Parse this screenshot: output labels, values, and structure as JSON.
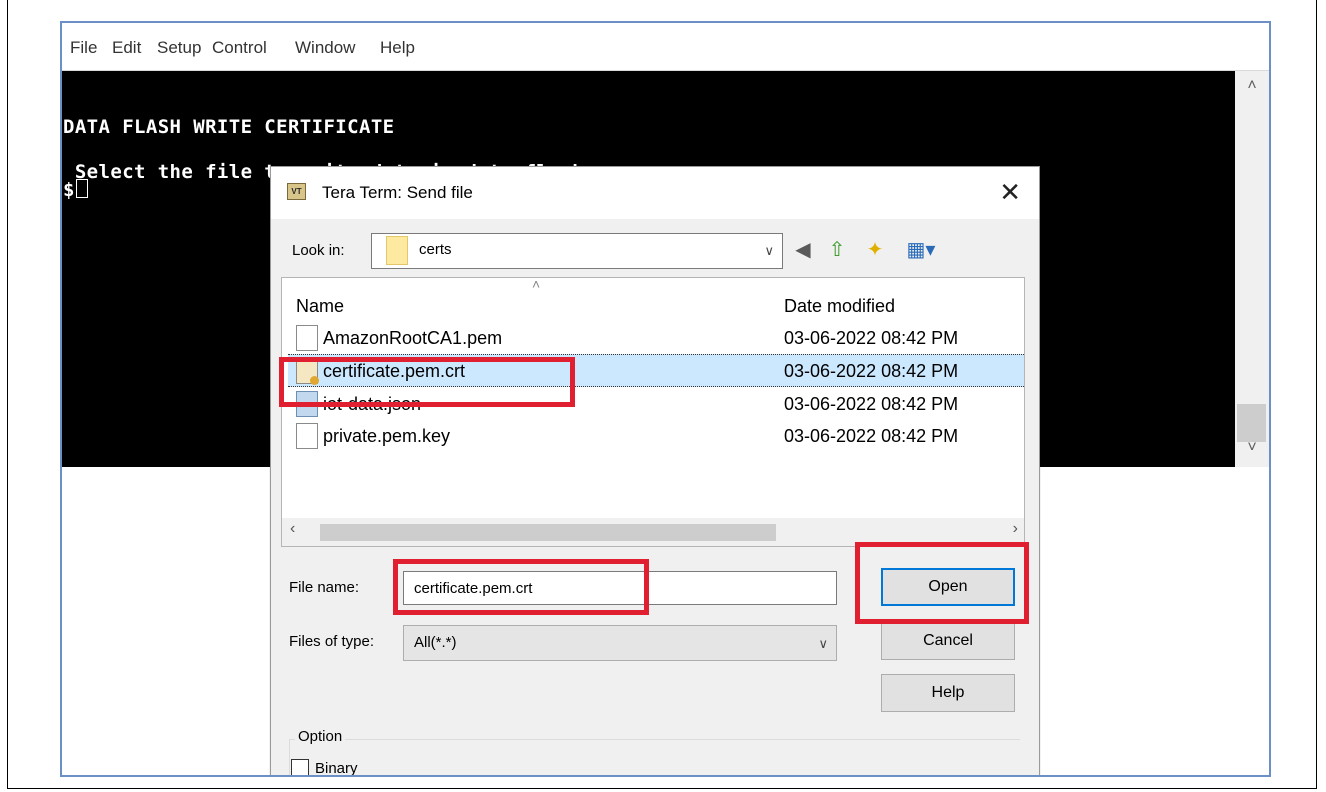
{
  "menu": [
    "File",
    "Edit",
    "Setup",
    "Control",
    "Window",
    "Help"
  ],
  "terminal": {
    "line1": "DATA FLASH WRITE CERTIFICATE",
    "line2": " Select the file to write data in data flash",
    "prompt": "$"
  },
  "dialog": {
    "title": "Tera Term: Send file",
    "icon_label": "VT",
    "look_in_label": "Look in:",
    "look_in_value": "certs",
    "columns": {
      "name": "Name",
      "date": "Date modified"
    },
    "files": [
      {
        "name": "AmazonRootCA1.pem",
        "date": "03-06-2022 08:42 PM",
        "icon": "file-icon"
      },
      {
        "name": "certificate.pem.crt",
        "date": "03-06-2022 08:42 PM",
        "icon": "certificate-icon",
        "selected": true
      },
      {
        "name": "iot-data.json",
        "date": "03-06-2022 08:42 PM",
        "icon": "json-file-icon"
      },
      {
        "name": "private.pem.key",
        "date": "03-06-2022 08:42 PM",
        "icon": "file-icon"
      }
    ],
    "file_name_label": "File name:",
    "file_name_value": "certificate.pem.crt",
    "files_of_type_label": "Files of type:",
    "files_of_type_value": "All(*.*)",
    "buttons": {
      "open": "Open",
      "cancel": "Cancel",
      "help": "Help"
    },
    "option_label": "Option",
    "binary_label": "Binary"
  },
  "colors": {
    "highlight": "#e02030",
    "selection": "#cce8ff",
    "terminal_bg": "#000000"
  }
}
